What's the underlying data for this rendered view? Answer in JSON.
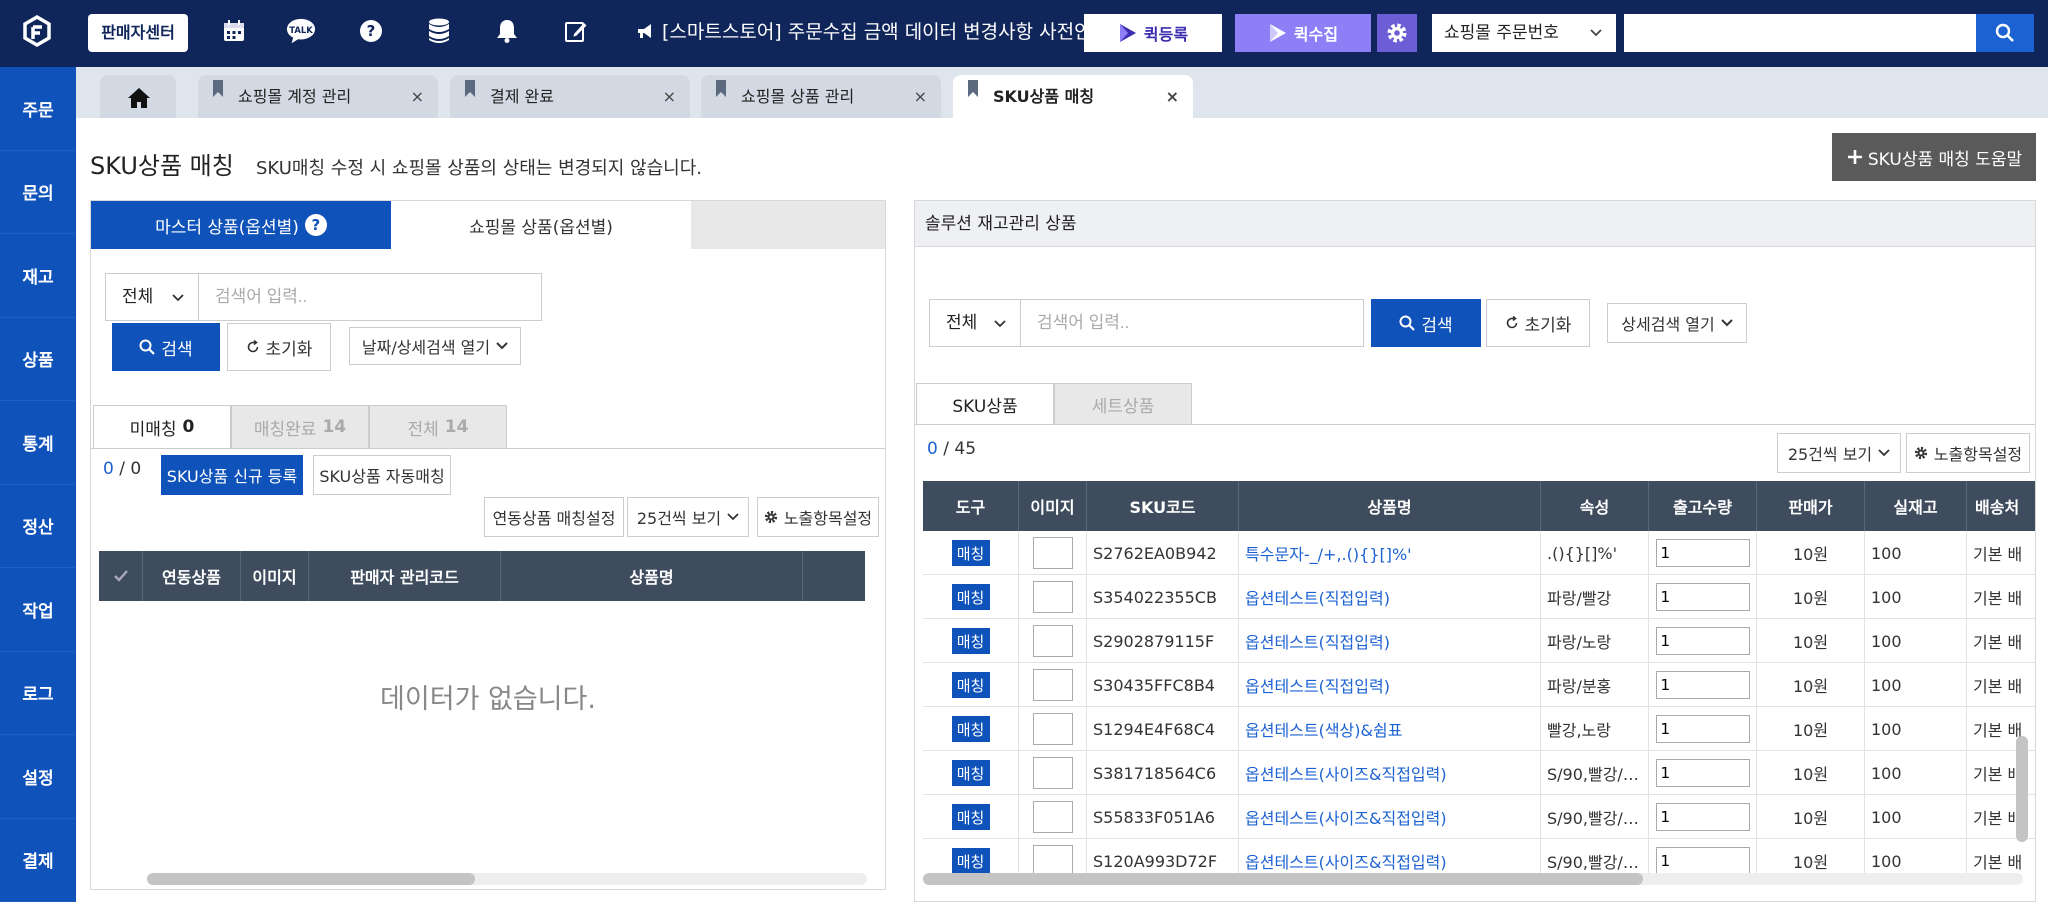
{
  "topbar": {
    "seller_center": "판매자센터",
    "notice": "[스마트스토어] 주문수집 금액 데이터 변경사항 사전안내",
    "quick_register": "퀵등록",
    "quick_collect": "퀵수집",
    "order_select": "쇼핑몰 주문번호",
    "search_value": "",
    "icons": [
      "calendar-icon",
      "talk-icon",
      "help-icon",
      "database-icon",
      "bell-icon",
      "edit-icon",
      "megaphone-icon"
    ],
    "colors": {
      "navy": "#10265a",
      "blue": "#0f52ba",
      "purple": "#8f7ff7"
    }
  },
  "sidebar": {
    "items": [
      {
        "key": "orders",
        "label": "주문"
      },
      {
        "key": "inquiry",
        "label": "문의"
      },
      {
        "key": "stock",
        "label": "재고"
      },
      {
        "key": "products",
        "label": "상품"
      },
      {
        "key": "stats",
        "label": "통계"
      },
      {
        "key": "settlement",
        "label": "정산"
      },
      {
        "key": "jobs",
        "label": "작업"
      },
      {
        "key": "logs",
        "label": "로그"
      },
      {
        "key": "settings",
        "label": "설정"
      },
      {
        "key": "payment",
        "label": "결제"
      }
    ]
  },
  "tabs": [
    {
      "label": "쇼핑몰 계정 관리",
      "active": false
    },
    {
      "label": "결제 완료",
      "active": false
    },
    {
      "label": "쇼핑몰 상품 관리",
      "active": false
    },
    {
      "label": "SKU상품 매칭",
      "active": true
    }
  ],
  "page": {
    "title": "SKU상품 매칭",
    "subtitle": "SKU매칭 수정 시 쇼핑몰 상품의 상태는 변경되지 않습니다.",
    "help_button": "SKU상품 매칭 도움말"
  },
  "left": {
    "tab_master": "마스터 상품(옵션별)",
    "tab_mall": "쇼핑몰 상품(옵션별)",
    "filter_select": "전체",
    "search_placeholder": "검색어 입력..",
    "search_btn": "검색",
    "reset_btn": "초기화",
    "detail_btn": "날짜/상세검색 열기",
    "status_tabs": [
      {
        "label": "미매칭",
        "count": "0"
      },
      {
        "label": "매칭완료",
        "count": "14"
      },
      {
        "label": "전체",
        "count": "14"
      }
    ],
    "selected": "0",
    "total": "0",
    "new_sku_btn": "SKU상품 신규 등록",
    "auto_match_btn": "SKU상품 자동매칭",
    "linked_setting_btn": "연동상품 매칭설정",
    "page_size": "25건씩 보기",
    "columns_btn": "노출항목설정",
    "table_headers": [
      "연동상품",
      "이미지",
      "판매자 관리코드",
      "상품명"
    ],
    "no_data": "데이터가 없습니다."
  },
  "right": {
    "header": "솔루션 재고관리 상품",
    "filter_select": "전체",
    "search_placeholder": "검색어 입력..",
    "search_btn": "검색",
    "reset_btn": "초기화",
    "detail_btn": "상세검색 열기",
    "tab_sku": "SKU상품",
    "tab_set": "세트상품",
    "selected": "0",
    "total": "45",
    "page_size": "25건씩 보기",
    "columns_btn": "노출항목설정",
    "table_headers": [
      "도구",
      "이미지",
      "SKU코드",
      "상품명",
      "속성",
      "출고수량",
      "판매가",
      "실재고",
      "배송처"
    ],
    "match_label": "매칭",
    "rows": [
      {
        "code": "S2762EA0B942",
        "name": "특수문자-_/+,.(){}[]%'",
        "attr": ".(){}[]%'",
        "qty": "1",
        "price": "10원",
        "stock": "100",
        "ship": "기본 배"
      },
      {
        "code": "S354022355CB",
        "name": "옵션테스트(직접입력)",
        "attr": "파랑/빨강",
        "qty": "1",
        "price": "10원",
        "stock": "100",
        "ship": "기본 배"
      },
      {
        "code": "S2902879115F",
        "name": "옵션테스트(직접입력)",
        "attr": "파랑/노랑",
        "qty": "1",
        "price": "10원",
        "stock": "100",
        "ship": "기본 배"
      },
      {
        "code": "S30435FFC8B4",
        "name": "옵션테스트(직접입력)",
        "attr": "파랑/분홍",
        "qty": "1",
        "price": "10원",
        "stock": "100",
        "ship": "기본 배"
      },
      {
        "code": "S1294E4F68C4",
        "name": "옵션테스트(색상)&쉼표",
        "attr": "빨강,노랑",
        "qty": "1",
        "price": "10원",
        "stock": "100",
        "ship": "기본 배"
      },
      {
        "code": "S381718564C6",
        "name": "옵션테스트(사이즈&직접입력)",
        "attr": "S/90,빨강/…",
        "qty": "1",
        "price": "10원",
        "stock": "100",
        "ship": "기본 배"
      },
      {
        "code": "S55833F051A6",
        "name": "옵션테스트(사이즈&직접입력)",
        "attr": "S/90,빨강/…",
        "qty": "1",
        "price": "10원",
        "stock": "100",
        "ship": "기본 배"
      },
      {
        "code": "S120A993D72F",
        "name": "옵션테스트(사이즈&직접입력)",
        "attr": "S/90,빨강/…",
        "qty": "1",
        "price": "10원",
        "stock": "100",
        "ship": "기본 배"
      }
    ]
  }
}
